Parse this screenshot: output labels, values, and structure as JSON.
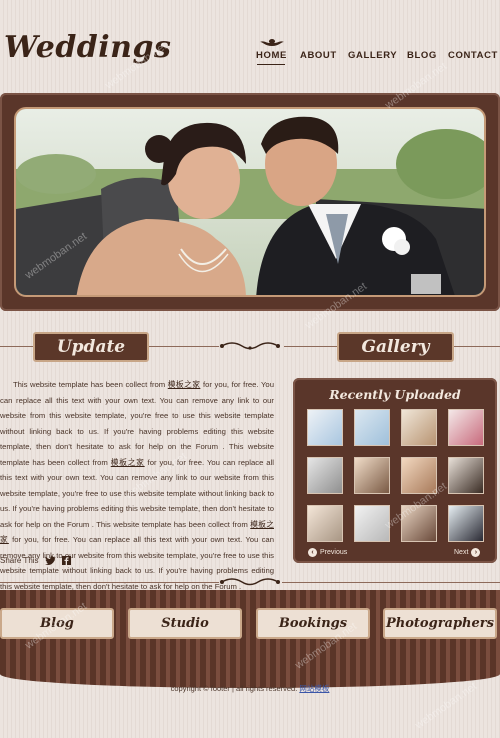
{
  "header": {
    "logo": "Weddings",
    "nav": [
      "HOME",
      "ABOUT",
      "GALLERY",
      "BLOG",
      "CONTACT"
    ]
  },
  "sections": {
    "update_title": "Update",
    "gallery_title": "Gallery"
  },
  "article": {
    "p1_a": "This website template has been collect from ",
    "link1": "模板之家",
    "p1_b": " for you, for free. You can replace all this text with your own text. You can remove any link to our website from this website template, you're free to use this website template without linking back to us. If you're having problems editing this website template, then don't hesitate to ask for help on the Forum . This website template has been collect from ",
    "link2": "模板之家",
    "p1_c": " for you, for free. You can replace all this text with your own text. You can remove any link to our website from this website template, you're free to use this website template without linking back to us. If you're having problems editing this website template, then don't hesitate to ask for help on the Forum . This website template has been collect from ",
    "link3": "模板之家",
    "p1_d": " for you, for free. You can replace all this text with your own text. You can remove any link to our website from this website template, you're free to use this website template without linking back to us. If you're having problems editing this website template, then don't hesitate to ask for help on the Forum .",
    "share_label": "Share This"
  },
  "gallery": {
    "title": "Recently Uploaded",
    "prev": "Previous",
    "next": "Next"
  },
  "footer_links": [
    "Blog",
    "Studio",
    "Bookings",
    "Photographers"
  ],
  "footer": {
    "copyright": "copyright © footer | all rights reserved. ",
    "link": "网站模板"
  },
  "watermark": "webmoban.net"
}
